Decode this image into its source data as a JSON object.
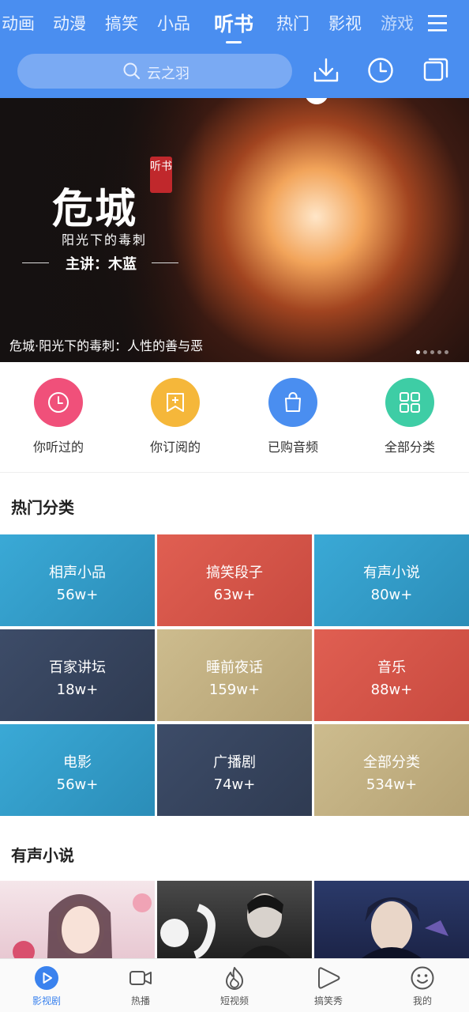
{
  "tabs": [
    "动画",
    "动漫",
    "搞笑",
    "小品",
    "听书",
    "热门",
    "影视",
    "游戏"
  ],
  "active_tab": "听书",
  "search": {
    "placeholder": "云之羽"
  },
  "banner": {
    "title": "危城",
    "seal": "听书",
    "subtitle": "阳光下的毒刺",
    "host": "主讲：木蓝",
    "caption": "危城·阳光下的毒刺：人性的善与恶",
    "slide_count": 5,
    "active_slide": 1
  },
  "shortcuts": [
    {
      "label": "你听过的",
      "icon": "clock-icon",
      "color": "#f0507a"
    },
    {
      "label": "你订阅的",
      "icon": "bookmark-add-icon",
      "color": "#f5b73a"
    },
    {
      "label": "已购音频",
      "icon": "bag-icon",
      "color": "#4a8ef0"
    },
    {
      "label": "全部分类",
      "icon": "grid-icon",
      "color": "#3ecda5"
    }
  ],
  "hot_section_title": "热门分类",
  "categories": [
    {
      "name": "相声小品",
      "count": "56w+",
      "color": "#3aa3cf"
    },
    {
      "name": "搞笑段子",
      "count": "63w+",
      "color": "#d9574a"
    },
    {
      "name": "有声小说",
      "count": "80w+",
      "color": "#3aa3cf"
    },
    {
      "name": "百家讲坛",
      "count": "18w+",
      "color": "#37455f"
    },
    {
      "name": "睡前夜话",
      "count": "159w+",
      "color": "#c4b282"
    },
    {
      "name": "音乐",
      "count": "88w+",
      "color": "#d9574a"
    },
    {
      "name": "电影",
      "count": "56w+",
      "color": "#3aa3cf"
    },
    {
      "name": "广播剧",
      "count": "74w+",
      "color": "#37455f"
    },
    {
      "name": "全部分类",
      "count": "534w+",
      "color": "#c4b282"
    }
  ],
  "novel_section_title": "有声小说",
  "bottom_nav": [
    {
      "label": "影视剧",
      "icon": "play-circle-icon",
      "active": true
    },
    {
      "label": "热播",
      "icon": "video-camera-icon",
      "active": false
    },
    {
      "label": "短视频",
      "icon": "flame-icon",
      "active": false
    },
    {
      "label": "搞笑秀",
      "icon": "play-bubble-icon",
      "active": false
    },
    {
      "label": "我的",
      "icon": "smiley-icon",
      "active": false
    }
  ]
}
